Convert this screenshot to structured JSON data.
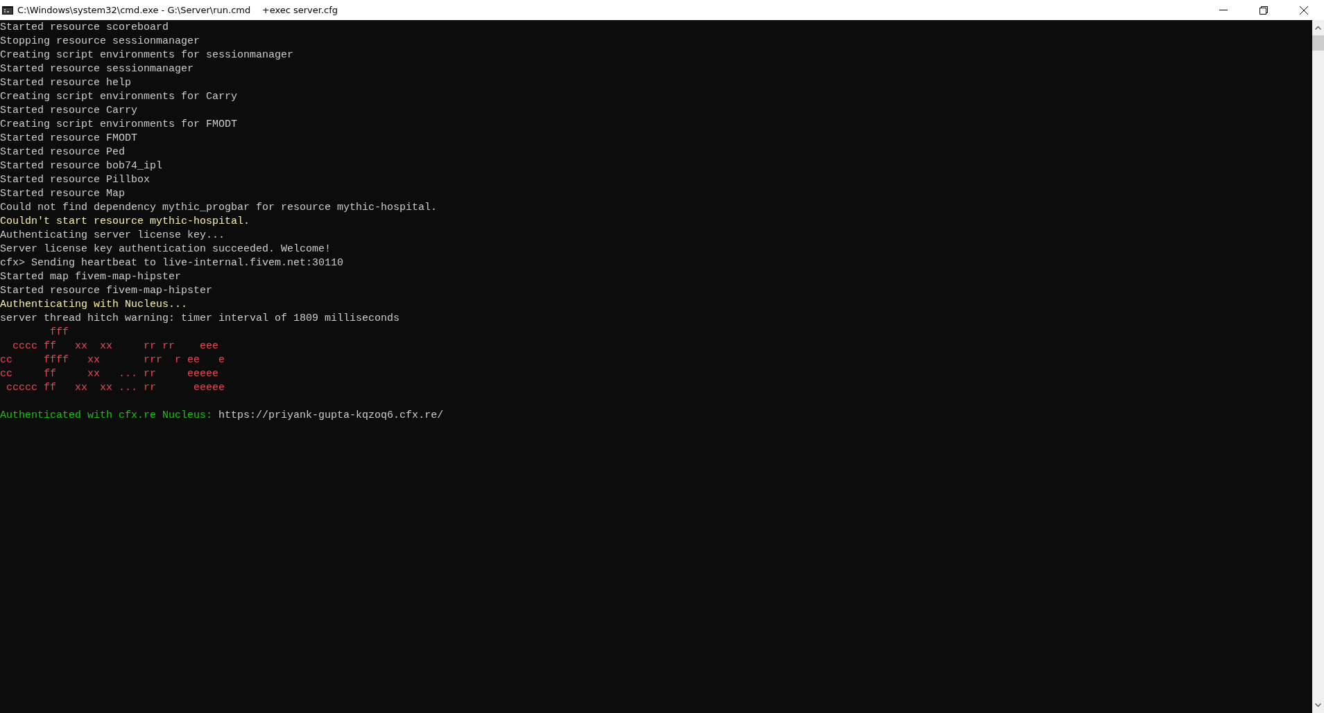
{
  "window": {
    "title": "C:\\Windows\\system32\\cmd.exe - G:\\Server\\run.cmd    +exec server.cfg"
  },
  "console": {
    "lines": [
      {
        "kind": "info",
        "text": "Started resource scoreboard"
      },
      {
        "kind": "info",
        "text": "Stopping resource sessionmanager"
      },
      {
        "kind": "info",
        "text": "Creating script environments for sessionmanager"
      },
      {
        "kind": "info",
        "text": "Started resource sessionmanager"
      },
      {
        "kind": "info",
        "text": "Started resource help"
      },
      {
        "kind": "info",
        "text": "Creating script environments for Carry"
      },
      {
        "kind": "info",
        "text": "Started resource Carry"
      },
      {
        "kind": "info",
        "text": "Creating script environments for FMODT"
      },
      {
        "kind": "info",
        "text": "Started resource FMODT"
      },
      {
        "kind": "info",
        "text": "Started resource Ped"
      },
      {
        "kind": "info",
        "text": "Started resource bob74_ipl"
      },
      {
        "kind": "info",
        "text": "Started resource Pillbox"
      },
      {
        "kind": "info",
        "text": "Started resource Map"
      },
      {
        "kind": "info",
        "text": "Could not find dependency mythic_progbar for resource mythic-hospital."
      },
      {
        "kind": "warning",
        "text": "Couldn't start resource mythic-hospital."
      },
      {
        "kind": "info",
        "text": "Authenticating server license key..."
      },
      {
        "kind": "info",
        "text": "Server license key authentication succeeded. Welcome!"
      },
      {
        "kind": "info",
        "text": "cfx> Sending heartbeat to live-internal.fivem.net:30110"
      },
      {
        "kind": "info",
        "text": "Started map fivem-map-hipster"
      },
      {
        "kind": "info",
        "text": "Started resource fivem-map-hipster"
      },
      {
        "kind": "warning",
        "text": "Authenticating with Nucleus..."
      },
      {
        "kind": "info",
        "text": "server thread hitch warning: timer interval of 1809 milliseconds"
      },
      {
        "kind": "art",
        "text": "        fff"
      },
      {
        "kind": "art",
        "text": "  cccc ff   xx  xx     rr rr    eee"
      },
      {
        "kind": "art",
        "text": "cc     ffff   xx       rrr  r ee   e"
      },
      {
        "kind": "art",
        "text": "cc     ff     xx   ... rr     eeeee"
      },
      {
        "kind": "art",
        "text": " ccccc ff   xx  xx ... rr      eeeee"
      },
      {
        "kind": "blank"
      },
      {
        "kind": "success",
        "label": "Authenticated with cfx.re Nucleus:",
        "url": "https://priyank-gupta-kqzoq6.cfx.re/"
      }
    ]
  }
}
